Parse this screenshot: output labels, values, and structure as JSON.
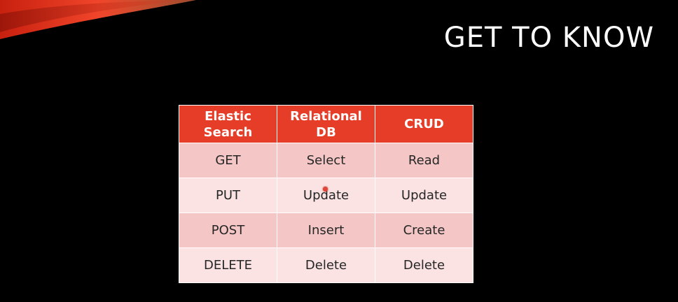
{
  "slide": {
    "title": "GET TO KNOW"
  },
  "colors": {
    "background": "#000000",
    "header_fill": "#e53d27",
    "row_dark": "#f4c7c6",
    "row_light": "#fae3e2",
    "accent_swoosh": "#e8321e"
  },
  "table": {
    "headers": [
      {
        "line1": "Elastic",
        "line2": "Search"
      },
      {
        "line1": "Relational",
        "line2": "DB"
      },
      {
        "line1": "CRUD",
        "line2": ""
      }
    ],
    "rows": [
      [
        "GET",
        "Select",
        "Read"
      ],
      [
        "PUT",
        "Update",
        "Update"
      ],
      [
        "POST",
        "Insert",
        "Create"
      ],
      [
        "DELETE",
        "Delete",
        "Delete"
      ]
    ]
  },
  "icons": {
    "decoration": "red-swoosh-decoration",
    "pointer": "laser-pointer-dot"
  }
}
